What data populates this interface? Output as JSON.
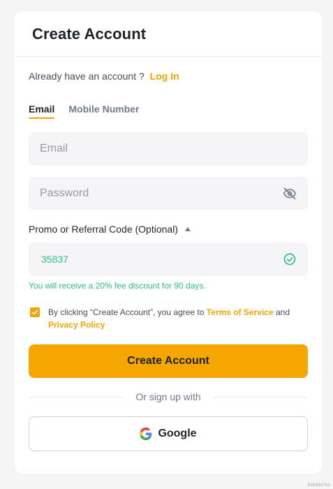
{
  "header": {
    "title": "Create Account"
  },
  "login_prompt": {
    "text": "Already have an account ?",
    "link": "Log In"
  },
  "tabs": [
    {
      "label": "Email",
      "active": true
    },
    {
      "label": "Mobile Number",
      "active": false
    }
  ],
  "email_field": {
    "placeholder": "Email",
    "value": ""
  },
  "password_field": {
    "placeholder": "Password",
    "value": "",
    "icon": "eye-off-icon"
  },
  "promo": {
    "label": "Promo or Referral Code (Optional)",
    "value": "35837",
    "status_icon": "check-circle-icon",
    "note": "You will receive a 20% fee discount for 90 days."
  },
  "agreement": {
    "checked": true,
    "prefix": "By clicking “Create Account”, you agree to",
    "terms_link": "Terms of Service",
    "conjunction": "and",
    "privacy_link": "Privacy Policy"
  },
  "create_button": {
    "label": "Create Account"
  },
  "divider": {
    "text": "Or sign up with"
  },
  "google_button": {
    "label": "Google",
    "icon": "google-icon"
  },
  "corner_mark": "B2B484762",
  "colors": {
    "accent": "#f0a500",
    "button": "#f5a600",
    "success": "#2ebd85",
    "field_bg": "#f5f5f8"
  }
}
